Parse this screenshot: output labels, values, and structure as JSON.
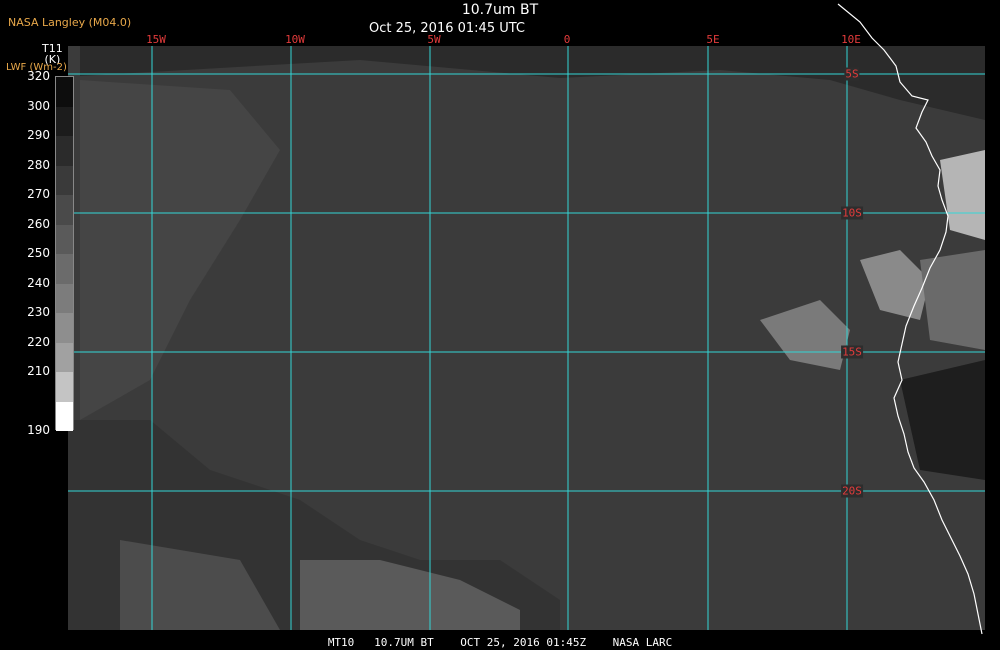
{
  "header": {
    "credit": "NASA Langley (M04.0)",
    "title": "10.7um BT",
    "subtitle": "Oct 25, 2016 01:45 UTC"
  },
  "legend": {
    "title": "T11",
    "title_unit": "(K)",
    "alt_unit": "LWF (Wm-2)",
    "labels": [
      "320",
      "300",
      "290",
      "280",
      "270",
      "260",
      "250",
      "240",
      "230",
      "220",
      "210",
      "190"
    ],
    "shades": [
      "#0d0d0d",
      "#1c1c1c",
      "#2b2b2b",
      "#3a3a3a",
      "#4a4a4a",
      "#5a5a5a",
      "#6b6b6b",
      "#7c7c7c",
      "#8e8e8e",
      "#a1a1a1",
      "#c4c4c4",
      "#ffffff"
    ]
  },
  "map": {
    "longitudes": [
      "15W",
      "10W",
      "5W",
      "0",
      "5E",
      "10E"
    ],
    "latitudes": [
      "5S",
      "10S",
      "15S",
      "20S"
    ],
    "grid_color": "#33d6d6",
    "coast_color": "#ffffff",
    "label_color": "#e23b3b"
  },
  "footer": {
    "text": "MT10   10.7UM BT    OCT 25, 2016 01:45Z    NASA LARC"
  }
}
